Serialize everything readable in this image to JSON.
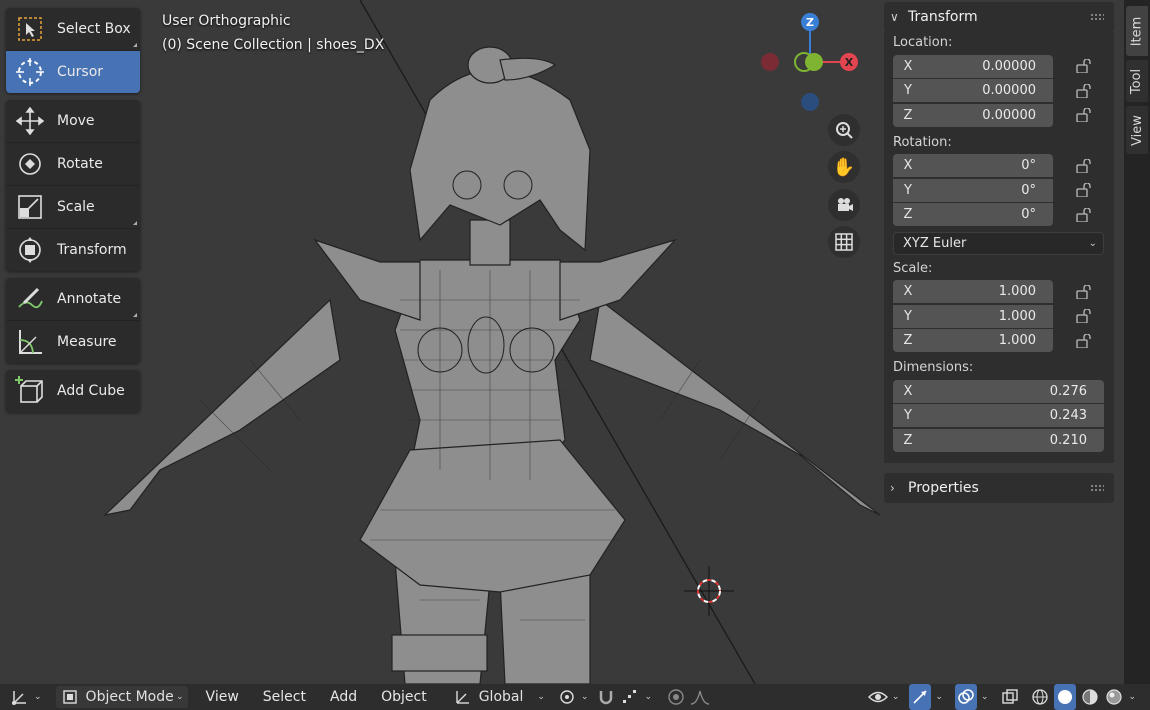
{
  "viewport": {
    "view_name": "User Orthographic",
    "collection_info": "(0) Scene Collection | shoes_DX"
  },
  "toolbar": {
    "tools": [
      {
        "label": "Select Box",
        "icon": "select-box-icon"
      },
      {
        "label": "Cursor",
        "icon": "cursor-icon",
        "active": true
      },
      {
        "label": "Move",
        "icon": "move-icon"
      },
      {
        "label": "Rotate",
        "icon": "rotate-icon"
      },
      {
        "label": "Scale",
        "icon": "scale-icon"
      },
      {
        "label": "Transform",
        "icon": "transform-icon"
      },
      {
        "label": "Annotate",
        "icon": "annotate-icon"
      },
      {
        "label": "Measure",
        "icon": "measure-icon"
      },
      {
        "label": "Add Cube",
        "icon": "add-cube-icon"
      }
    ]
  },
  "gizmo": {
    "z_label": "Z",
    "x_label": "X",
    "colors": {
      "x": "#e24550",
      "y": "#7fb332",
      "z": "#3a7fd6"
    }
  },
  "npanel": {
    "transform_title": "Transform",
    "location_label": "Location:",
    "location": [
      {
        "axis": "X",
        "value": "0.00000"
      },
      {
        "axis": "Y",
        "value": "0.00000"
      },
      {
        "axis": "Z",
        "value": "0.00000"
      }
    ],
    "rotation_label": "Rotation:",
    "rotation": [
      {
        "axis": "X",
        "value": "0°"
      },
      {
        "axis": "Y",
        "value": "0°"
      },
      {
        "axis": "Z",
        "value": "0°"
      }
    ],
    "rotation_mode": "XYZ Euler",
    "scale_label": "Scale:",
    "scale": [
      {
        "axis": "X",
        "value": "1.000"
      },
      {
        "axis": "Y",
        "value": "1.000"
      },
      {
        "axis": "Z",
        "value": "1.000"
      }
    ],
    "dimensions_label": "Dimensions:",
    "dimensions": [
      {
        "axis": "X",
        "value": "0.276"
      },
      {
        "axis": "Y",
        "value": "0.243"
      },
      {
        "axis": "Z",
        "value": "0.210"
      }
    ],
    "properties_title": "Properties"
  },
  "side_tabs": [
    "Item",
    "Tool",
    "View"
  ],
  "header": {
    "mode": "Object Mode",
    "menus": [
      "View",
      "Select",
      "Add",
      "Object"
    ],
    "orientation": "Global"
  }
}
